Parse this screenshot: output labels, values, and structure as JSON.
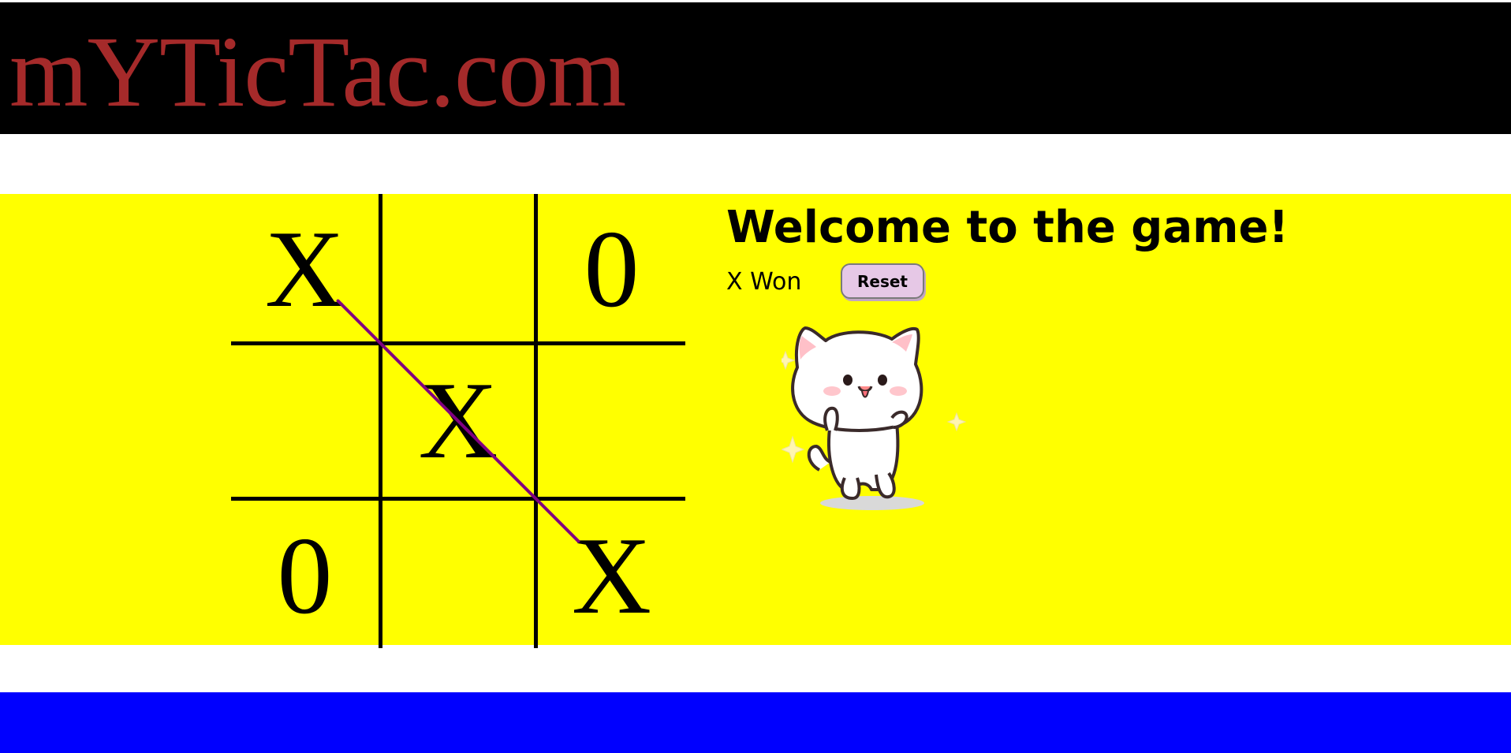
{
  "header": {
    "site_title": "mYTicTac.com",
    "title_color": "#a52a2a",
    "background": "#000000"
  },
  "game": {
    "area_color": "#ffff00",
    "board": [
      [
        "X",
        "",
        "0"
      ],
      [
        "",
        "X",
        ""
      ],
      [
        "0",
        "",
        "X"
      ]
    ],
    "winning_line": {
      "cells": [
        [
          0,
          0
        ],
        [
          1,
          1
        ],
        [
          2,
          2
        ]
      ],
      "color": "#800080"
    }
  },
  "info": {
    "title": "Welcome to the game!",
    "status": "X Won",
    "reset_label": "Reset",
    "reset_color": "#e6c8e6",
    "gif": "dancing-cat-image"
  },
  "footer": {
    "background": "#0000ff"
  }
}
